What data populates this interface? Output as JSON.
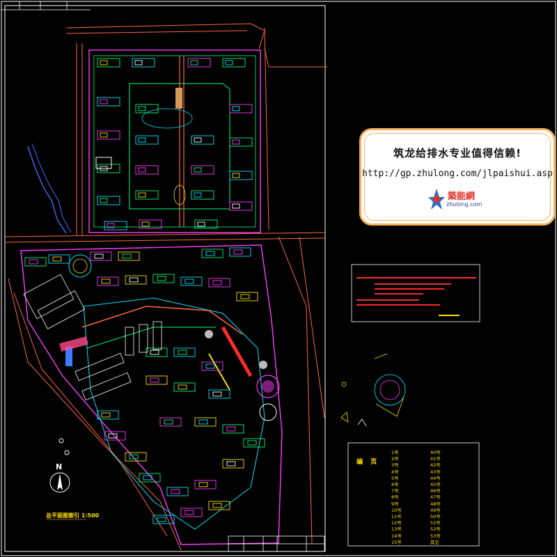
{
  "drawing": {
    "corner_mark": "",
    "scale_label": "总平面图索引 1:500",
    "north_label": "N"
  },
  "watermark": {
    "title": "筑龙给排水专业值得信赖!",
    "url": "http://gp.zhulong.com/jlpaishui.asp",
    "logo_name": "築能網",
    "logo_domain": "zhulong.com"
  },
  "legend": {
    "title": "编 页",
    "left_column": [
      "1号",
      "2号",
      "3号",
      "4号",
      "5号",
      "6号",
      "7号",
      "8号",
      "9号",
      "10号",
      "11号",
      "12号",
      "13号",
      "14号",
      "15号"
    ],
    "right_column": [
      "40号",
      "41号",
      "42号",
      "43号",
      "44号",
      "45号",
      "46号",
      "47号",
      "48号",
      "49号",
      "50号",
      "51号",
      "52号",
      "53号",
      "其它"
    ]
  },
  "colors": {
    "background": "#000000",
    "frame": "#ffffff",
    "roads": "#ff6a3d",
    "buildings": "#00ff7a",
    "accent_cyan": "#00e5ff",
    "accent_magenta": "#ff3cff",
    "accent_yellow": "#ffe000",
    "notes_red": "#ff2a2a",
    "watermark_border": "#f4b05a"
  }
}
